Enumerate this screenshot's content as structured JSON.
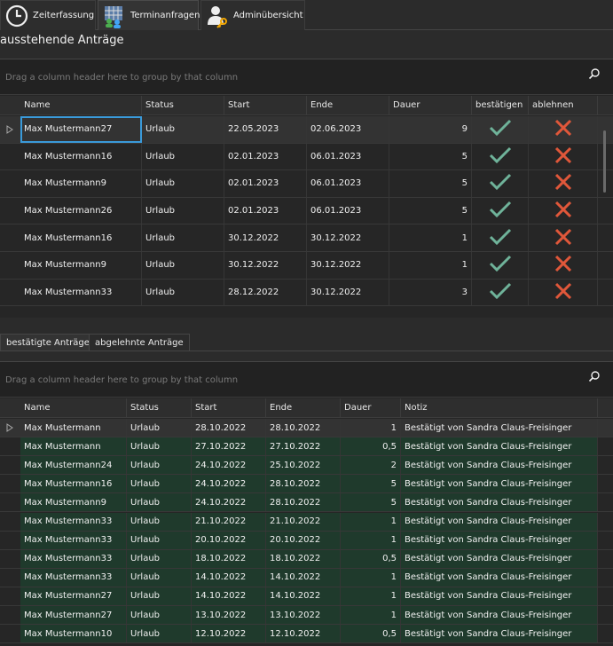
{
  "nav": {
    "tabs": [
      {
        "label": "Zeiterfassung",
        "icon": "clock-icon"
      },
      {
        "label": "Terminanfragen",
        "icon": "calendar-users-icon"
      },
      {
        "label": "Adminübersicht",
        "icon": "admin-key-icon"
      }
    ]
  },
  "pending": {
    "title": "ausstehende Anträge",
    "group_hint": "Drag a column header here to group by that column",
    "columns": [
      "Name",
      "Status",
      "Start",
      "Ende",
      "Dauer",
      "bestätigen",
      "ablehnen"
    ],
    "rows": [
      {
        "name": "Max Mustermann27",
        "status": "Urlaub",
        "start": "22.05.2023",
        "end": "02.06.2023",
        "duration": "9"
      },
      {
        "name": "Max Mustermann16",
        "status": "Urlaub",
        "start": "02.01.2023",
        "end": "06.01.2023",
        "duration": "5"
      },
      {
        "name": "Max Mustermann9",
        "status": "Urlaub",
        "start": "02.01.2023",
        "end": "06.01.2023",
        "duration": "5"
      },
      {
        "name": "Max Mustermann26",
        "status": "Urlaub",
        "start": "02.01.2023",
        "end": "06.01.2023",
        "duration": "5"
      },
      {
        "name": "Max Mustermann16",
        "status": "Urlaub",
        "start": "30.12.2022",
        "end": "30.12.2022",
        "duration": "1"
      },
      {
        "name": "Max Mustermann9",
        "status": "Urlaub",
        "start": "30.12.2022",
        "end": "30.12.2022",
        "duration": "1"
      },
      {
        "name": "Max Mustermann33",
        "status": "Urlaub",
        "start": "28.12.2022",
        "end": "30.12.2022",
        "duration": "3"
      }
    ]
  },
  "subtabs": [
    "bestätigte Anträge",
    "abgelehnte Anträge"
  ],
  "approved": {
    "group_hint": "Drag a column header here to group by that column",
    "columns": [
      "Name",
      "Status",
      "Start",
      "Ende",
      "Dauer",
      "Notiz"
    ],
    "rows": [
      {
        "name": "Max Mustermann",
        "status": "Urlaub",
        "start": "28.10.2022",
        "end": "28.10.2022",
        "duration": "1",
        "note": "Bestätigt von Sandra Claus-Freisinger"
      },
      {
        "name": "Max Mustermann",
        "status": "Urlaub",
        "start": "27.10.2022",
        "end": "27.10.2022",
        "duration": "0,5",
        "note": "Bestätigt von Sandra Claus-Freisinger"
      },
      {
        "name": "Max Mustermann24",
        "status": "Urlaub",
        "start": "24.10.2022",
        "end": "25.10.2022",
        "duration": "2",
        "note": "Bestätigt von Sandra Claus-Freisinger"
      },
      {
        "name": "Max Mustermann16",
        "status": "Urlaub",
        "start": "24.10.2022",
        "end": "28.10.2022",
        "duration": "5",
        "note": "Bestätigt von Sandra Claus-Freisinger"
      },
      {
        "name": "Max Mustermann9",
        "status": "Urlaub",
        "start": "24.10.2022",
        "end": "28.10.2022",
        "duration": "5",
        "note": "Bestätigt von Sandra Claus-Freisinger"
      },
      {
        "name": "Max Mustermann33",
        "status": "Urlaub",
        "start": "21.10.2022",
        "end": "21.10.2022",
        "duration": "1",
        "note": "Bestätigt von Sandra Claus-Freisinger"
      },
      {
        "name": "Max Mustermann33",
        "status": "Urlaub",
        "start": "20.10.2022",
        "end": "20.10.2022",
        "duration": "1",
        "note": "Bestätigt von Sandra Claus-Freisinger"
      },
      {
        "name": "Max Mustermann33",
        "status": "Urlaub",
        "start": "18.10.2022",
        "end": "18.10.2022",
        "duration": "0,5",
        "note": "Bestätigt von Sandra Claus-Freisinger"
      },
      {
        "name": "Max Mustermann33",
        "status": "Urlaub",
        "start": "14.10.2022",
        "end": "14.10.2022",
        "duration": "1",
        "note": "Bestätigt von Sandra Claus-Freisinger"
      },
      {
        "name": "Max Mustermann27",
        "status": "Urlaub",
        "start": "14.10.2022",
        "end": "14.10.2022",
        "duration": "1",
        "note": "Bestätigt von Sandra Claus-Freisinger"
      },
      {
        "name": "Max Mustermann27",
        "status": "Urlaub",
        "start": "13.10.2022",
        "end": "13.10.2022",
        "duration": "1",
        "note": "Bestätigt von Sandra Claus-Freisinger"
      },
      {
        "name": "Max Mustermann10",
        "status": "Urlaub",
        "start": "12.10.2022",
        "end": "12.10.2022",
        "duration": "0,5",
        "note": "Bestätigt von Sandra Claus-Freisinger"
      }
    ]
  },
  "colors": {
    "confirm": "#6fb39a",
    "reject": "#e0573a",
    "approved_row": "#1f3a2c",
    "focus": "#3a9ad9"
  }
}
